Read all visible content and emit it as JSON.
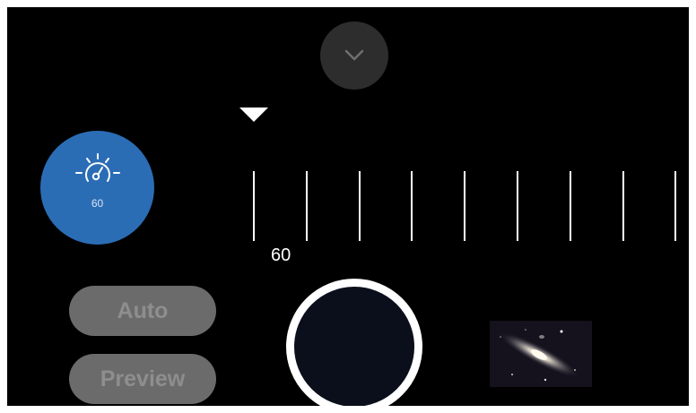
{
  "header": {
    "collapse_icon": "chevron-down-icon"
  },
  "exposure": {
    "icon": "speedometer-icon",
    "value": "60",
    "accent_color": "#2b6db5"
  },
  "ruler": {
    "indicator_icon": "triangle-down-icon",
    "current_value": "60"
  },
  "controls": {
    "auto_label": "Auto",
    "preview_label": "Preview"
  },
  "capture": {
    "shutter_color": "#ffffff"
  },
  "gallery": {
    "thumbnail_icon": "galaxy-thumbnail"
  }
}
